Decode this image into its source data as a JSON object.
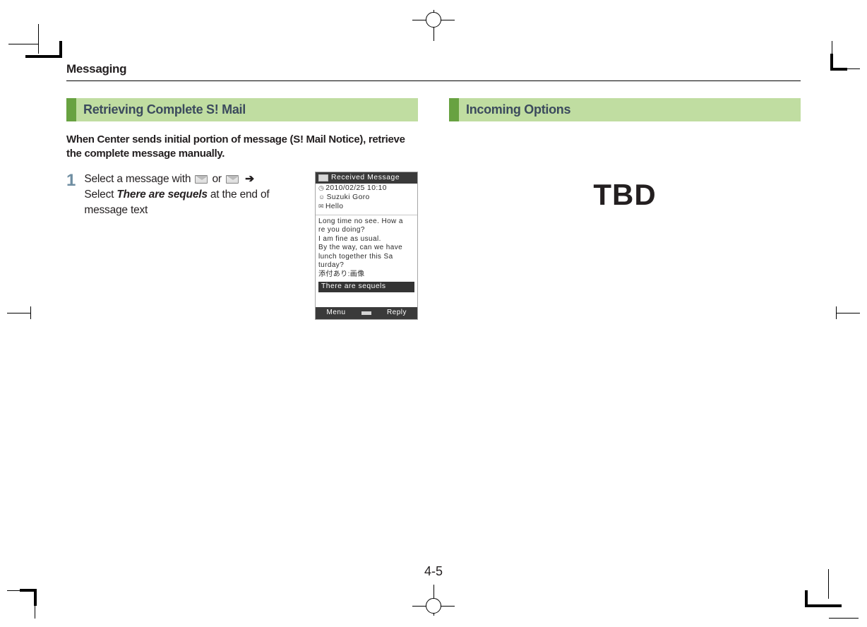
{
  "chapter": "Messaging",
  "page_number": "4-5",
  "left": {
    "section_title": "Retrieving Complete S! Mail",
    "intro": "When Center sends initial portion of message (S! Mail Notice), retrieve the complete message manually.",
    "step_number": "1",
    "step_part1": "Select a message with ",
    "step_part_or": " or ",
    "step_part_arrow": "➔",
    "step_part2a": "Select ",
    "step_sequels": "There are sequels",
    "step_part2b": " at the end of message text"
  },
  "phone": {
    "title": "Received Message",
    "time": "2010/02/25 10:10",
    "from": "Suzuki Goro",
    "subject": "Hello",
    "body_line1": "Long time no see. How a",
    "body_line2": "re you doing?",
    "body_line3": "I am fine as usual.",
    "body_line4": "By the way, can we have",
    "body_line5": " lunch together this Sa",
    "body_line6": "turday?",
    "body_line7": "添付あり:画像",
    "sequels_bar": "There are sequels",
    "soft_left": "Menu",
    "soft_right": "Reply"
  },
  "right": {
    "section_title": "Incoming Options",
    "tbd": "TBD"
  }
}
